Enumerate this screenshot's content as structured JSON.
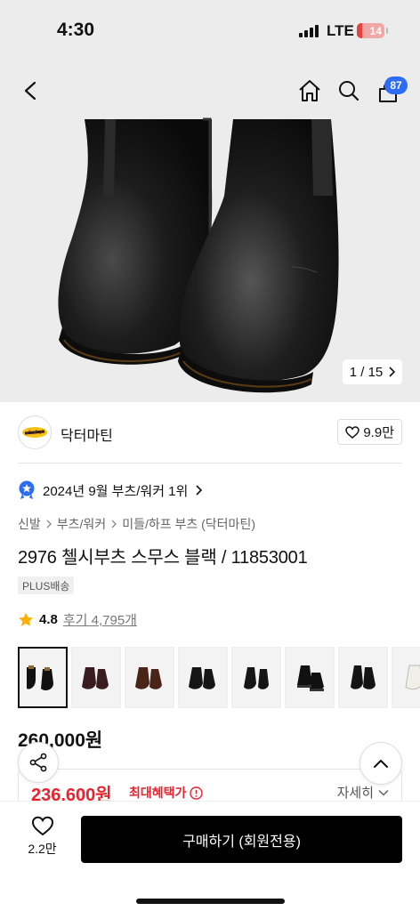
{
  "status_bar": {
    "time": "4:30",
    "network": "LTE",
    "battery": "14",
    "battery_color": "#e8423c"
  },
  "nav": {
    "back_icon": "chevron-left-icon",
    "home_icon": "home-icon",
    "search_icon": "search-icon",
    "cart_icon": "shopping-bag-icon",
    "cart_count": "87"
  },
  "gallery": {
    "current": "1",
    "separator": "/",
    "total": "15",
    "text": "1 / 15"
  },
  "brand": {
    "name": "닥터마틴",
    "likes": "9.9만"
  },
  "ranking": {
    "text": "2024년 9월 부츠/워커 1위"
  },
  "breadcrumb": [
    "신발",
    "부츠/워커",
    "미들/하프 부츠 (닥터마틴)"
  ],
  "product": {
    "title": "2976 첼시부츠 스무스 블랙 / 11853001",
    "delivery_badge": "PLUS배송"
  },
  "rating": {
    "score": "4.8",
    "review_label": "후기 4,795개",
    "stars": 4.8
  },
  "thumbnails": [
    "black",
    "burgundy",
    "brown",
    "black",
    "black",
    "black-platform",
    "black",
    "white"
  ],
  "pricing": {
    "original": "260,000원",
    "discounted": "236,600원",
    "max_benefit_label": "최대혜택가",
    "detail_label": "자세히",
    "accent_color": "#e9232d"
  },
  "bottom_bar": {
    "wish_count": "2.2만",
    "buy_label": "구매하기 (회원전용)"
  }
}
